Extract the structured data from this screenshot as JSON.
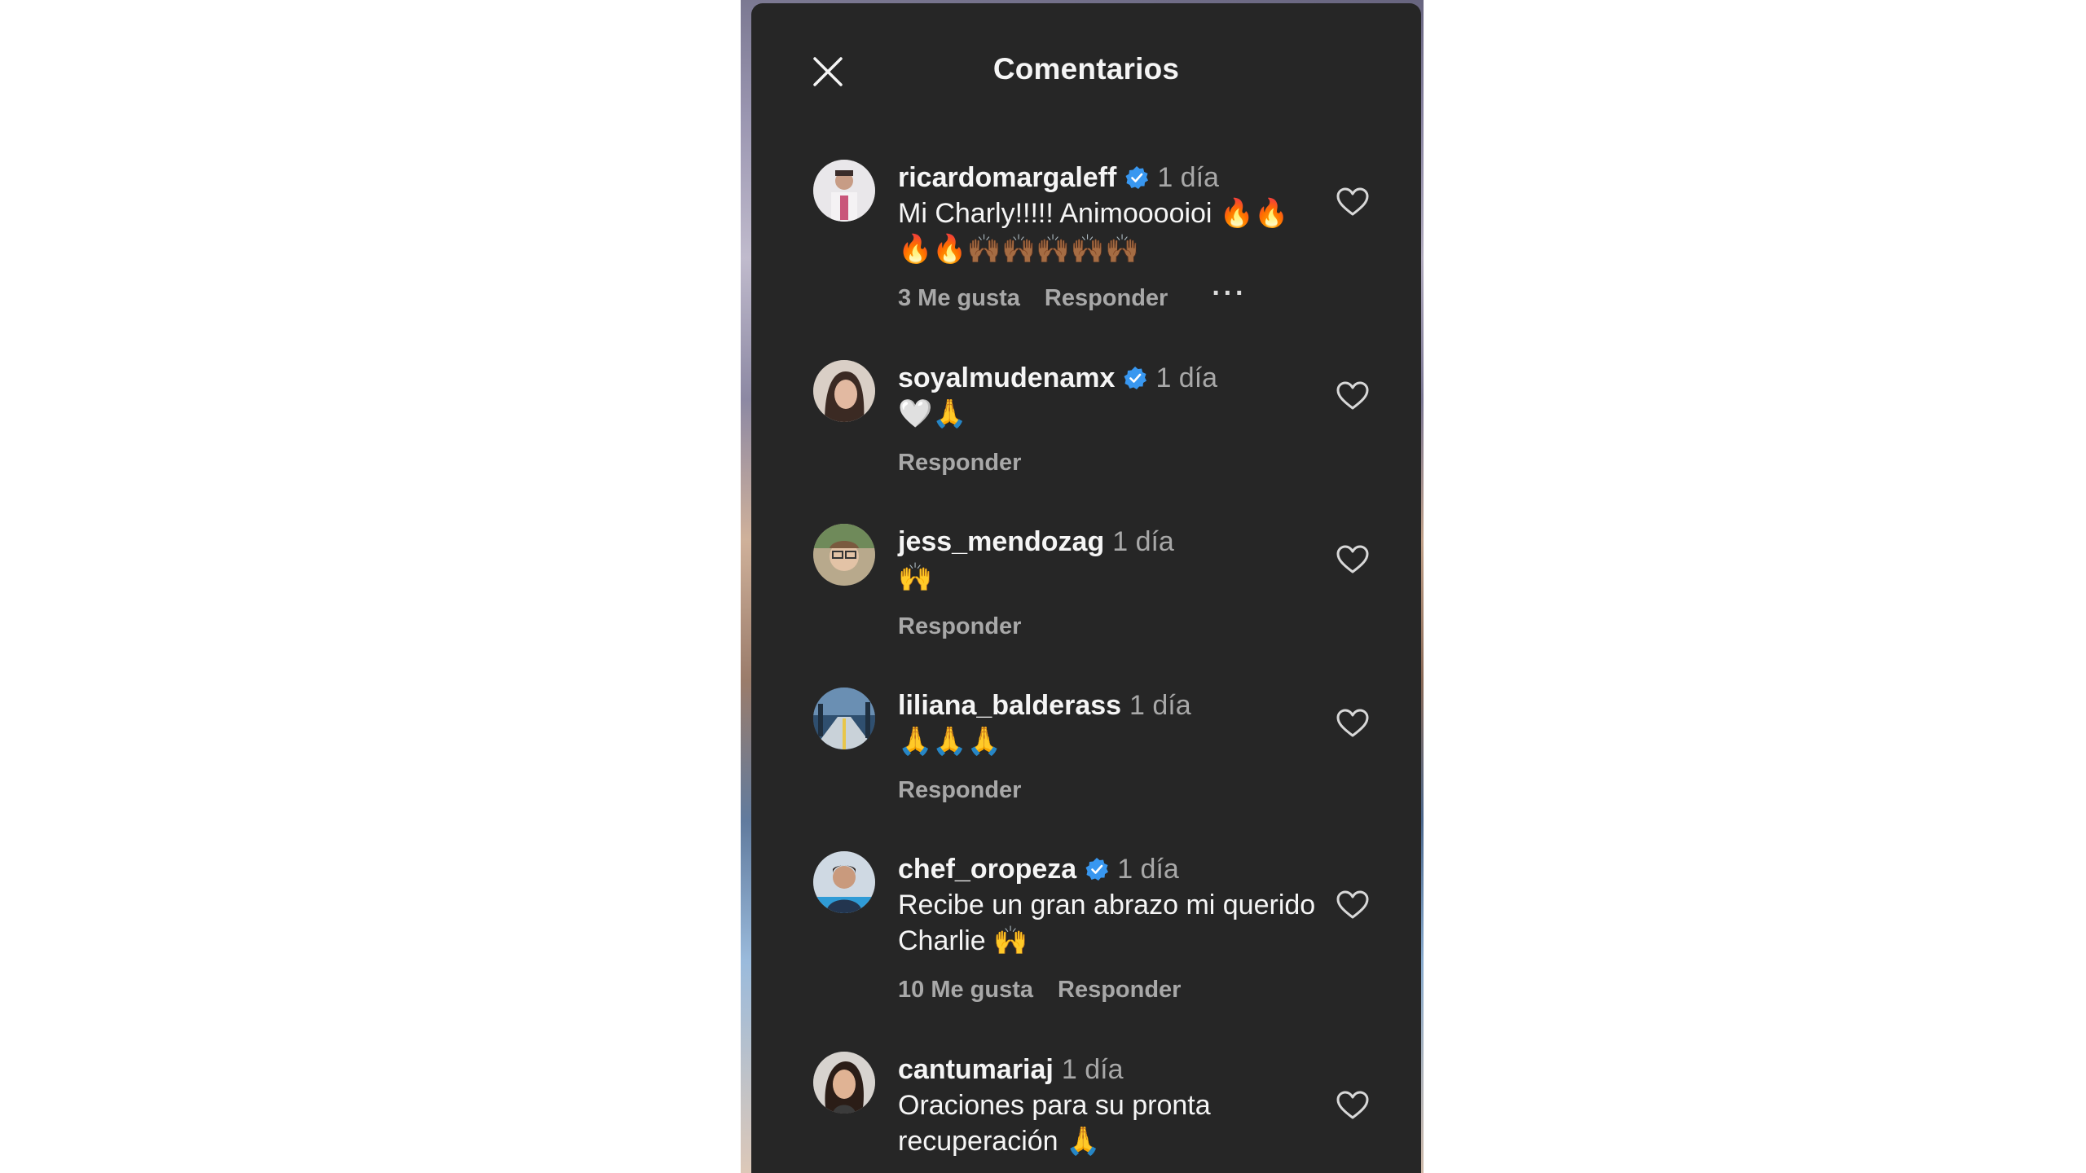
{
  "panel": {
    "title": "Comentarios",
    "close_icon": "close-icon"
  },
  "colors": {
    "panel_bg": "#262626",
    "text_primary": "#f5f5f5",
    "text_secondary": "#a8a8a8",
    "verified_blue": "#3897f0"
  },
  "comments": [
    {
      "username": "ricardomargaleff",
      "verified": true,
      "time": "1 día",
      "text": "Mi Charly!!!!! Animooooioi 🔥🔥🔥🔥🙌🏾🙌🏾🙌🏾🙌🏾🙌🏾",
      "likes": "3 Me gusta",
      "reply": "Responder",
      "more": "···"
    },
    {
      "username": "soyalmudenamx",
      "verified": true,
      "time": "1 día",
      "text": "🤍🙏",
      "reply": "Responder"
    },
    {
      "username": "jess_mendozag",
      "verified": false,
      "time": "1 día",
      "text": "🙌",
      "reply": "Responder"
    },
    {
      "username": "liliana_balderass",
      "verified": false,
      "time": "1 día",
      "text": "🙏🙏🙏",
      "reply": "Responder"
    },
    {
      "username": "chef_oropeza",
      "verified": true,
      "time": "1 día",
      "text": "Recibe un gran abrazo mi querido Charlie 🙌",
      "likes": "10 Me gusta",
      "reply": "Responder"
    },
    {
      "username": "cantumariaj",
      "verified": false,
      "time": "1 día",
      "text": "Oraciones para su pronta recuperación 🙏"
    }
  ]
}
